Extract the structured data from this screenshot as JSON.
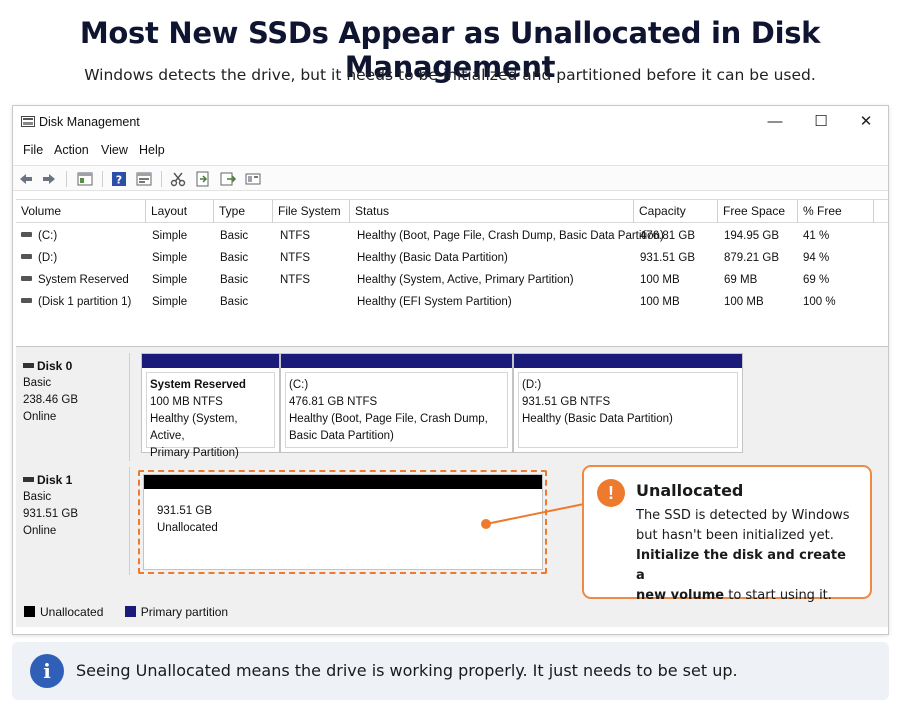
{
  "header": {
    "title": "Most New SSDs Appear as Unallocated in Disk Management",
    "subtitle": "Windows detects the drive, but it needs to be initialized and partitioned before it can be used."
  },
  "window": {
    "title": "Disk Management",
    "controls": {
      "minimize": "—",
      "maximize": "☐",
      "close": "✕"
    }
  },
  "menu": [
    "File",
    "Action",
    "View",
    "Help"
  ],
  "toolbar_icons": [
    "back-icon",
    "forward-icon",
    "console-tree-icon",
    "help-icon",
    "properties-icon",
    "cut-icon",
    "import-icon",
    "export-icon",
    "view-icon"
  ],
  "volume_table": {
    "columns": [
      "Volume",
      "Layout",
      "Type",
      "File System",
      "Status",
      "Capacity",
      "Free Space",
      "% Free"
    ],
    "rows": [
      [
        "(C:)",
        "Simple",
        "Basic",
        "NTFS",
        "Healthy (Boot, Page File, Crash Dump, Basic Data Partition)",
        "476.81 GB",
        "194.95 GB",
        "41 %"
      ],
      [
        "(D:)",
        "Simple",
        "Basic",
        "NTFS",
        "Healthy (Basic Data Partition)",
        "931.51 GB",
        "879.21 GB",
        "94 %"
      ],
      [
        "System Reserved",
        "Simple",
        "Basic",
        "NTFS",
        "Healthy (System, Active, Primary Partition)",
        "100 MB",
        "69 MB",
        "69 %"
      ],
      [
        "(Disk 1 partition 1)",
        "Simple",
        "Basic",
        "",
        "Healthy (EFI System Partition)",
        "100 MB",
        "100 MB",
        "100 %"
      ]
    ]
  },
  "disks": [
    {
      "name": "Disk 0",
      "type": "Basic",
      "size": "238.46 GB",
      "status": "Online",
      "partitions": [
        {
          "name": "System Reserved",
          "size": "100 MB NTFS",
          "status_lines": [
            "Healthy (System, Active,",
            "Primary Partition)"
          ]
        },
        {
          "name": "(C:)",
          "size": "476.81 GB NTFS",
          "status_lines": [
            "Healthy (Boot, Page File, Crash Dump,",
            "Basic Data Partition)"
          ]
        },
        {
          "name": "(D:)",
          "size": "931.51 GB NTFS",
          "status_lines": [
            "Healthy (Basic Data Partition)"
          ]
        }
      ]
    },
    {
      "name": "Disk 1",
      "type": "Basic",
      "size": "931.51 GB",
      "status": "Online",
      "unallocated": {
        "size": "931.51 GB",
        "label": "Unallocated"
      }
    }
  ],
  "legend": [
    {
      "label": "Unallocated",
      "color": "#000000"
    },
    {
      "label": "Primary partition",
      "color": "#1a1a7a"
    }
  ],
  "callout": {
    "icon": "!",
    "title": "Unallocated",
    "line1": "The SSD is detected by Windows",
    "line2": "but hasn't been initialized yet.",
    "bold1": "Initialize the disk and create a",
    "bold2": "new volume",
    "tail2": " to start using it."
  },
  "info": {
    "icon": "i",
    "text": "Seeing Unallocated means the drive is working properly. It just needs to be set up."
  },
  "colors": {
    "accent": "#ee7a2e",
    "primary_partition": "#1a1a7a",
    "info_blue": "#2f5fb7"
  }
}
